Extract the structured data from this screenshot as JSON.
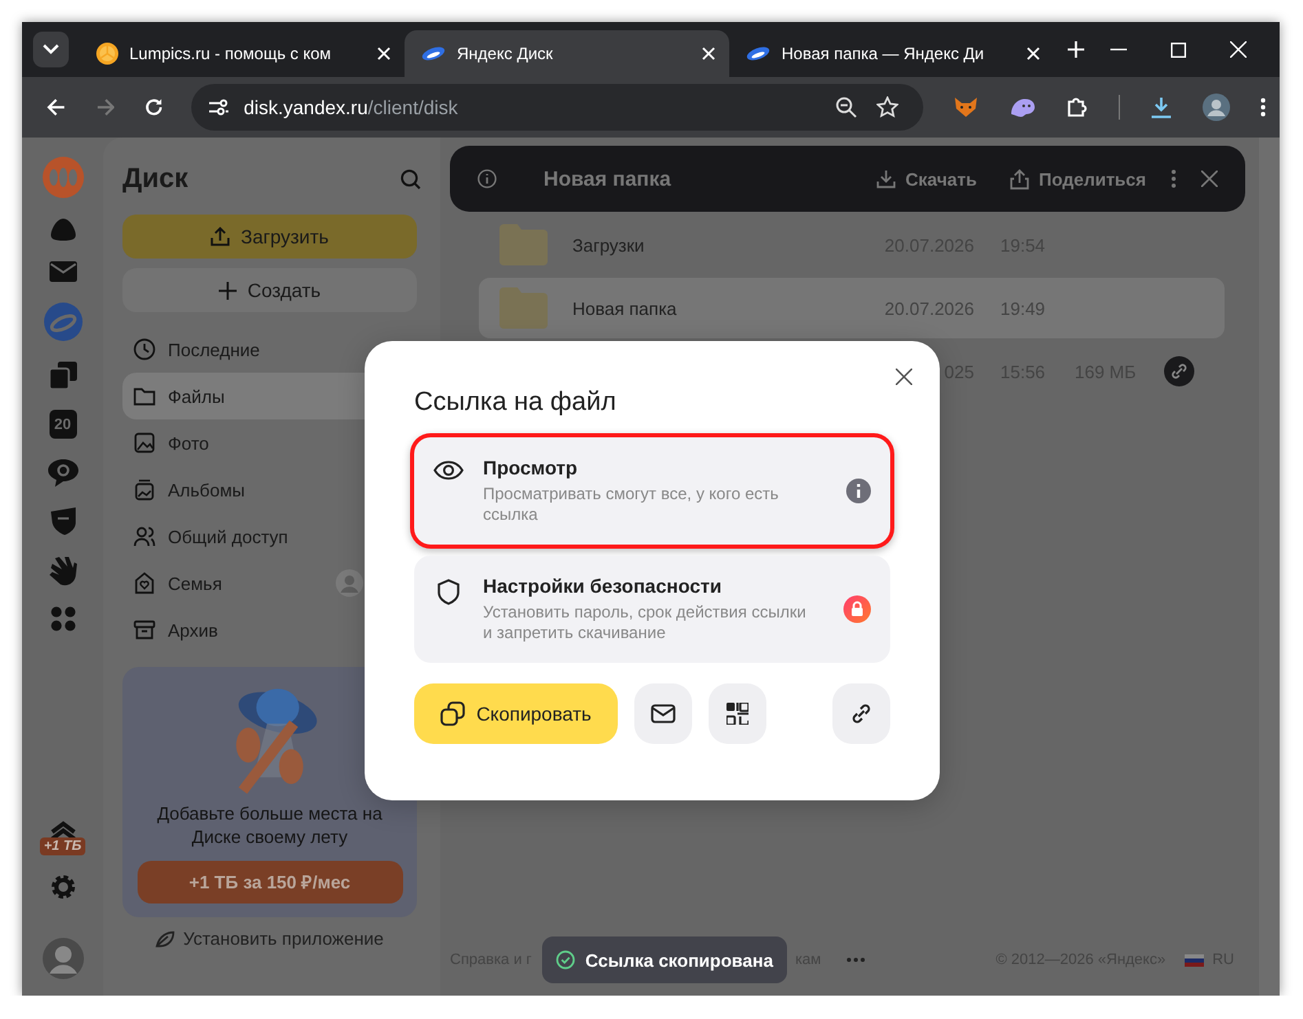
{
  "browser": {
    "tabs": [
      {
        "title": "Lumpics.ru - помощь с ком",
        "kind": "orange",
        "selected": false
      },
      {
        "title": "Яндекс Диск",
        "kind": "disk",
        "selected": true
      },
      {
        "title": "Новая папка — Яндекс Ди",
        "kind": "disk",
        "selected": false
      }
    ],
    "nav_buttons": [
      {
        "kind": "back",
        "disabled": false
      },
      {
        "kind": "forward",
        "disabled": true
      },
      {
        "kind": "reload",
        "disabled": false
      }
    ],
    "address": {
      "host": "disk.yandex.ru",
      "path": "/client/disk"
    }
  },
  "rail": {
    "calendar_label": "20",
    "upgrade_badge": "+1 ТБ"
  },
  "sidebar": {
    "title": "Диск",
    "upload": "Загрузить",
    "create": "Создать",
    "items": [
      {
        "label": "Последние",
        "kind": "clock",
        "selected": false
      },
      {
        "label": "Файлы",
        "kind": "folder",
        "selected": true
      },
      {
        "label": "Фото",
        "kind": "photo",
        "selected": false
      },
      {
        "label": "Альбомы",
        "kind": "album",
        "selected": false
      },
      {
        "label": "Общий доступ",
        "kind": "people",
        "selected": false
      },
      {
        "label": "Семья",
        "kind": "family",
        "selected": false
      },
      {
        "label": "Архив",
        "kind": "archive",
        "selected": false
      }
    ],
    "promo": {
      "text": "Добавьте больше места на Диске своему лету",
      "button": "+1 ТБ за 150 ₽/мес"
    },
    "install": "Установить приложение"
  },
  "toolbar": {
    "title": "Новая папка",
    "download": "Скачать",
    "share": "Поделиться"
  },
  "files": [
    {
      "name": "Загрузки",
      "date": "20.07.2026",
      "time": "19:54",
      "selected": false,
      "shared": false
    },
    {
      "name": "Новая папка",
      "date": "20.07.2026",
      "time": "19:49",
      "selected": true,
      "shared": false
    },
    {
      "date": "025",
      "time": "15:56",
      "size": "169 МБ",
      "selected": false,
      "shared": true
    }
  ],
  "footer": {
    "help": "Справка и г",
    "tail": "кам",
    "copyright": "© 2012—2026  «Яндекс»",
    "lang": "RU"
  },
  "modal": {
    "title": "Ссылка на файл",
    "options": [
      {
        "kind": "view",
        "title": "Просмотр",
        "text": "Просматривать смогут все, у кого есть ссылка",
        "highlighted": true
      },
      {
        "kind": "security",
        "title": "Настройки безопасности",
        "text": "Установить пароль, срок действия ссылки и запретить скачивание",
        "highlighted": false
      }
    ],
    "copy": "Скопировать"
  },
  "toast": {
    "text": "Ссылка скопирована"
  }
}
